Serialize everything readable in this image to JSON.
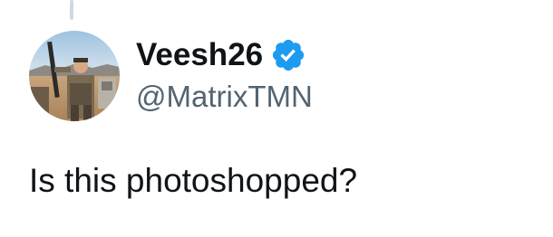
{
  "tweet": {
    "author": {
      "display_name": "Veesh26",
      "handle": "@MatrixTMN",
      "verified": true,
      "verified_icon": "verified-badge-icon",
      "verified_color": "#1d9bf0"
    },
    "text": "Is this photoshopped?"
  },
  "colors": {
    "text_primary": "#0f1419",
    "text_secondary": "#536471",
    "thread_line": "#cfd9de"
  }
}
